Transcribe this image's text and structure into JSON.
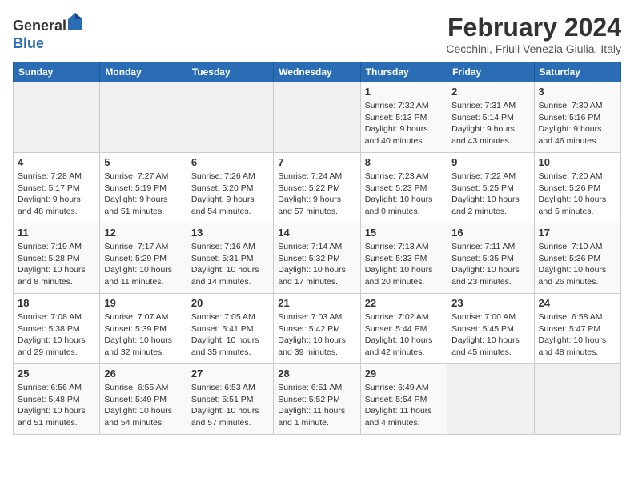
{
  "header": {
    "logo_general": "General",
    "logo_blue": "Blue",
    "title": "February 2024",
    "subtitle": "Cecchini, Friuli Venezia Giulia, Italy"
  },
  "days_of_week": [
    "Sunday",
    "Monday",
    "Tuesday",
    "Wednesday",
    "Thursday",
    "Friday",
    "Saturday"
  ],
  "weeks": [
    {
      "days": [
        {
          "number": "",
          "info": ""
        },
        {
          "number": "",
          "info": ""
        },
        {
          "number": "",
          "info": ""
        },
        {
          "number": "",
          "info": ""
        },
        {
          "number": "1",
          "info": "Sunrise: 7:32 AM\nSunset: 5:13 PM\nDaylight: 9 hours\nand 40 minutes."
        },
        {
          "number": "2",
          "info": "Sunrise: 7:31 AM\nSunset: 5:14 PM\nDaylight: 9 hours\nand 43 minutes."
        },
        {
          "number": "3",
          "info": "Sunrise: 7:30 AM\nSunset: 5:16 PM\nDaylight: 9 hours\nand 46 minutes."
        }
      ]
    },
    {
      "days": [
        {
          "number": "4",
          "info": "Sunrise: 7:28 AM\nSunset: 5:17 PM\nDaylight: 9 hours\nand 48 minutes."
        },
        {
          "number": "5",
          "info": "Sunrise: 7:27 AM\nSunset: 5:19 PM\nDaylight: 9 hours\nand 51 minutes."
        },
        {
          "number": "6",
          "info": "Sunrise: 7:26 AM\nSunset: 5:20 PM\nDaylight: 9 hours\nand 54 minutes."
        },
        {
          "number": "7",
          "info": "Sunrise: 7:24 AM\nSunset: 5:22 PM\nDaylight: 9 hours\nand 57 minutes."
        },
        {
          "number": "8",
          "info": "Sunrise: 7:23 AM\nSunset: 5:23 PM\nDaylight: 10 hours\nand 0 minutes."
        },
        {
          "number": "9",
          "info": "Sunrise: 7:22 AM\nSunset: 5:25 PM\nDaylight: 10 hours\nand 2 minutes."
        },
        {
          "number": "10",
          "info": "Sunrise: 7:20 AM\nSunset: 5:26 PM\nDaylight: 10 hours\nand 5 minutes."
        }
      ]
    },
    {
      "days": [
        {
          "number": "11",
          "info": "Sunrise: 7:19 AM\nSunset: 5:28 PM\nDaylight: 10 hours\nand 8 minutes."
        },
        {
          "number": "12",
          "info": "Sunrise: 7:17 AM\nSunset: 5:29 PM\nDaylight: 10 hours\nand 11 minutes."
        },
        {
          "number": "13",
          "info": "Sunrise: 7:16 AM\nSunset: 5:31 PM\nDaylight: 10 hours\nand 14 minutes."
        },
        {
          "number": "14",
          "info": "Sunrise: 7:14 AM\nSunset: 5:32 PM\nDaylight: 10 hours\nand 17 minutes."
        },
        {
          "number": "15",
          "info": "Sunrise: 7:13 AM\nSunset: 5:33 PM\nDaylight: 10 hours\nand 20 minutes."
        },
        {
          "number": "16",
          "info": "Sunrise: 7:11 AM\nSunset: 5:35 PM\nDaylight: 10 hours\nand 23 minutes."
        },
        {
          "number": "17",
          "info": "Sunrise: 7:10 AM\nSunset: 5:36 PM\nDaylight: 10 hours\nand 26 minutes."
        }
      ]
    },
    {
      "days": [
        {
          "number": "18",
          "info": "Sunrise: 7:08 AM\nSunset: 5:38 PM\nDaylight: 10 hours\nand 29 minutes."
        },
        {
          "number": "19",
          "info": "Sunrise: 7:07 AM\nSunset: 5:39 PM\nDaylight: 10 hours\nand 32 minutes."
        },
        {
          "number": "20",
          "info": "Sunrise: 7:05 AM\nSunset: 5:41 PM\nDaylight: 10 hours\nand 35 minutes."
        },
        {
          "number": "21",
          "info": "Sunrise: 7:03 AM\nSunset: 5:42 PM\nDaylight: 10 hours\nand 39 minutes."
        },
        {
          "number": "22",
          "info": "Sunrise: 7:02 AM\nSunset: 5:44 PM\nDaylight: 10 hours\nand 42 minutes."
        },
        {
          "number": "23",
          "info": "Sunrise: 7:00 AM\nSunset: 5:45 PM\nDaylight: 10 hours\nand 45 minutes."
        },
        {
          "number": "24",
          "info": "Sunrise: 6:58 AM\nSunset: 5:47 PM\nDaylight: 10 hours\nand 48 minutes."
        }
      ]
    },
    {
      "days": [
        {
          "number": "25",
          "info": "Sunrise: 6:56 AM\nSunset: 5:48 PM\nDaylight: 10 hours\nand 51 minutes."
        },
        {
          "number": "26",
          "info": "Sunrise: 6:55 AM\nSunset: 5:49 PM\nDaylight: 10 hours\nand 54 minutes."
        },
        {
          "number": "27",
          "info": "Sunrise: 6:53 AM\nSunset: 5:51 PM\nDaylight: 10 hours\nand 57 minutes."
        },
        {
          "number": "28",
          "info": "Sunrise: 6:51 AM\nSunset: 5:52 PM\nDaylight: 11 hours\nand 1 minute."
        },
        {
          "number": "29",
          "info": "Sunrise: 6:49 AM\nSunset: 5:54 PM\nDaylight: 11 hours\nand 4 minutes."
        },
        {
          "number": "",
          "info": ""
        },
        {
          "number": "",
          "info": ""
        }
      ]
    }
  ]
}
